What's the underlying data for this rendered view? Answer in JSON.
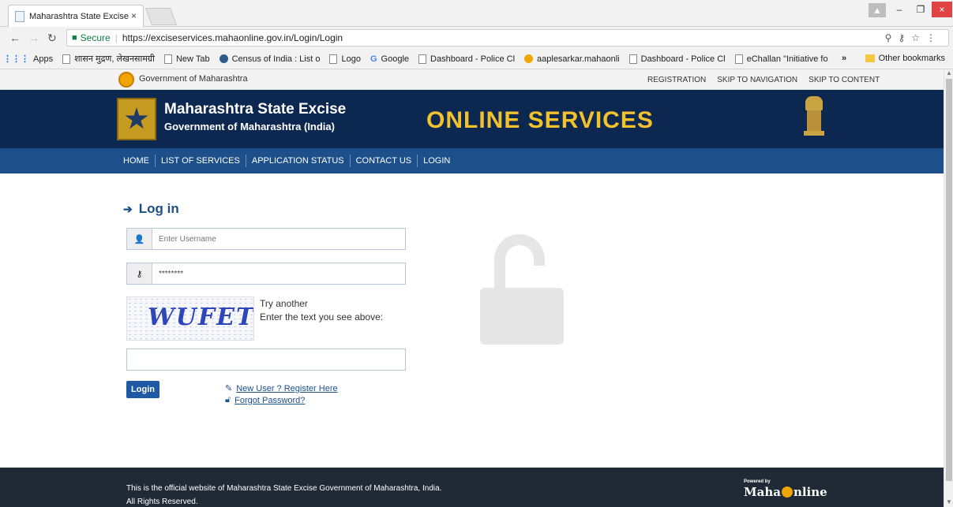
{
  "browser": {
    "tab_title": "Maharashtra State Excise",
    "tab_close": "×",
    "window_controls": {
      "min": "–",
      "max": "❐",
      "close": "×",
      "user": "▲"
    },
    "address": {
      "secure_label": "Secure",
      "url": "https://exciseservices.mahaonline.gov.in/Login/Login"
    },
    "bookmarks": [
      {
        "label": "Apps",
        "icon": "apps-icon"
      },
      {
        "label": "शासन मुद्रण, लेखनसामग्री",
        "icon": "page-icon"
      },
      {
        "label": "New Tab",
        "icon": "page-icon"
      },
      {
        "label": "Census of India : List o",
        "icon": "census-icon"
      },
      {
        "label": "Logo",
        "icon": "page-icon"
      },
      {
        "label": "Google",
        "icon": "google-icon"
      },
      {
        "label": "Dashboard - Police Cl",
        "icon": "page-icon"
      },
      {
        "label": "aaplesarkar.mahaonli",
        "icon": "dot-icon"
      },
      {
        "label": "Dashboard - Police Cl",
        "icon": "page-icon"
      },
      {
        "label": "eChallan \"Initiative fo",
        "icon": "page-icon"
      }
    ],
    "bookmarks_overflow": "»",
    "other_bookmarks": "Other bookmarks"
  },
  "header": {
    "gov_label": "Government of Maharashtra",
    "top_links": [
      "REGISTRATION",
      "SKIP TO NAVIGATION",
      "SKIP TO CONTENT"
    ],
    "brand_title": "Maharashtra State Excise",
    "brand_subtitle": "Government of Maharashtra (India)",
    "online_services": "ONLINE SERVICES"
  },
  "nav": {
    "items": [
      "HOME",
      "LIST OF SERVICES",
      "APPLICATION STATUS",
      "CONTACT US",
      "LOGIN"
    ]
  },
  "login": {
    "heading": "Log in",
    "username_placeholder": "Enter Username",
    "password_value": "********",
    "captcha_text": "WUFET",
    "try_another": "Try another",
    "captcha_hint": "Enter the text you see above:",
    "login_button": "Login",
    "register_link": "New User ? Register Here",
    "forgot_link": "Forgot Password?"
  },
  "footer": {
    "line1": "This is the official website of Maharashtra State Excise Government of Maharashtra, India.",
    "line2": "All Rights Reserved.",
    "powered_by": "Powered by",
    "maha": "Maha",
    "nline": "nline"
  },
  "colors": {
    "banner": "#0d2850",
    "navbar": "#1d4f8a",
    "accent_yellow": "#f2c12e",
    "footer": "#1f2a36"
  }
}
